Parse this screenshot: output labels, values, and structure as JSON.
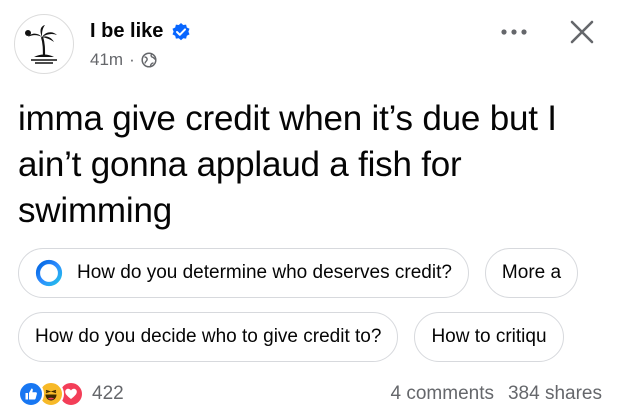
{
  "post": {
    "author": "I be like",
    "verified": true,
    "time": "41m",
    "separator": "·",
    "audience_icon": "globe-icon",
    "text": "imma give credit when it’s due but I ain’t gonna applaud a fish for swimming"
  },
  "header_actions": {
    "more_icon": "more-options-icon",
    "close_icon": "close-icon"
  },
  "suggestions": {
    "row1": [
      {
        "label": "How do you determine who deserves credit?",
        "icon": "meta-ai-ring-icon"
      },
      {
        "label": "More a"
      }
    ],
    "row2": [
      {
        "label": "How do you decide who to give credit to?"
      },
      {
        "label": "How to critiqu"
      }
    ]
  },
  "footer": {
    "reaction_icons": [
      "like-icon",
      "haha-icon",
      "love-icon"
    ],
    "reaction_count": "422",
    "comments": "4 comments",
    "shares": "384 shares"
  },
  "colors": {
    "verified_blue": "#0866ff",
    "like_blue": "#1877f2",
    "haha_yellow": "#f7b928",
    "love_red": "#f33e58",
    "secondary_text": "#65676b"
  }
}
